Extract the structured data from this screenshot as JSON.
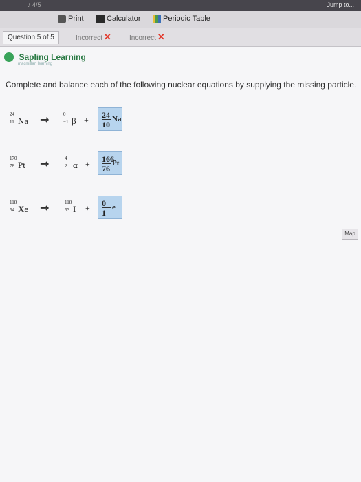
{
  "topbar": {
    "left_text": "♪ 4/5",
    "right_text": "Jump to..."
  },
  "toolbar": {
    "print_label": "Print",
    "calculator_label": "Calculator",
    "periodic_label": "Periodic Table"
  },
  "tabs": {
    "question_label": "Question 5 of 5",
    "incorrect1": "Incorrect",
    "incorrect2": "Incorrect"
  },
  "brand": {
    "name": "Sapling Learning",
    "sub": "macmillan learning"
  },
  "map_label": "Map",
  "instruction": "Complete and balance each of the following nuclear equations by supplying the missing particle.",
  "equations": [
    {
      "reactant": {
        "mass": "24",
        "atomic": "11",
        "symbol": "Na"
      },
      "given": {
        "mass": "0",
        "atomic": "−1",
        "symbol": "β"
      },
      "answer": {
        "mass": "24",
        "atomic": "10",
        "symbol": "Na"
      }
    },
    {
      "reactant": {
        "mass": "170",
        "atomic": "78",
        "symbol": "Pt"
      },
      "given": {
        "mass": "4",
        "atomic": "2",
        "symbol": "α"
      },
      "answer": {
        "mass": "166",
        "atomic": "76",
        "symbol": "Pt"
      }
    },
    {
      "reactant": {
        "mass": "118",
        "atomic": "54",
        "symbol": "Xe"
      },
      "given": {
        "mass": "118",
        "atomic": "53",
        "symbol": "I"
      },
      "answer": {
        "mass": "0",
        "atomic": "1",
        "symbol": "e"
      }
    }
  ],
  "symbols": {
    "arrow": "→",
    "plus": "+"
  }
}
